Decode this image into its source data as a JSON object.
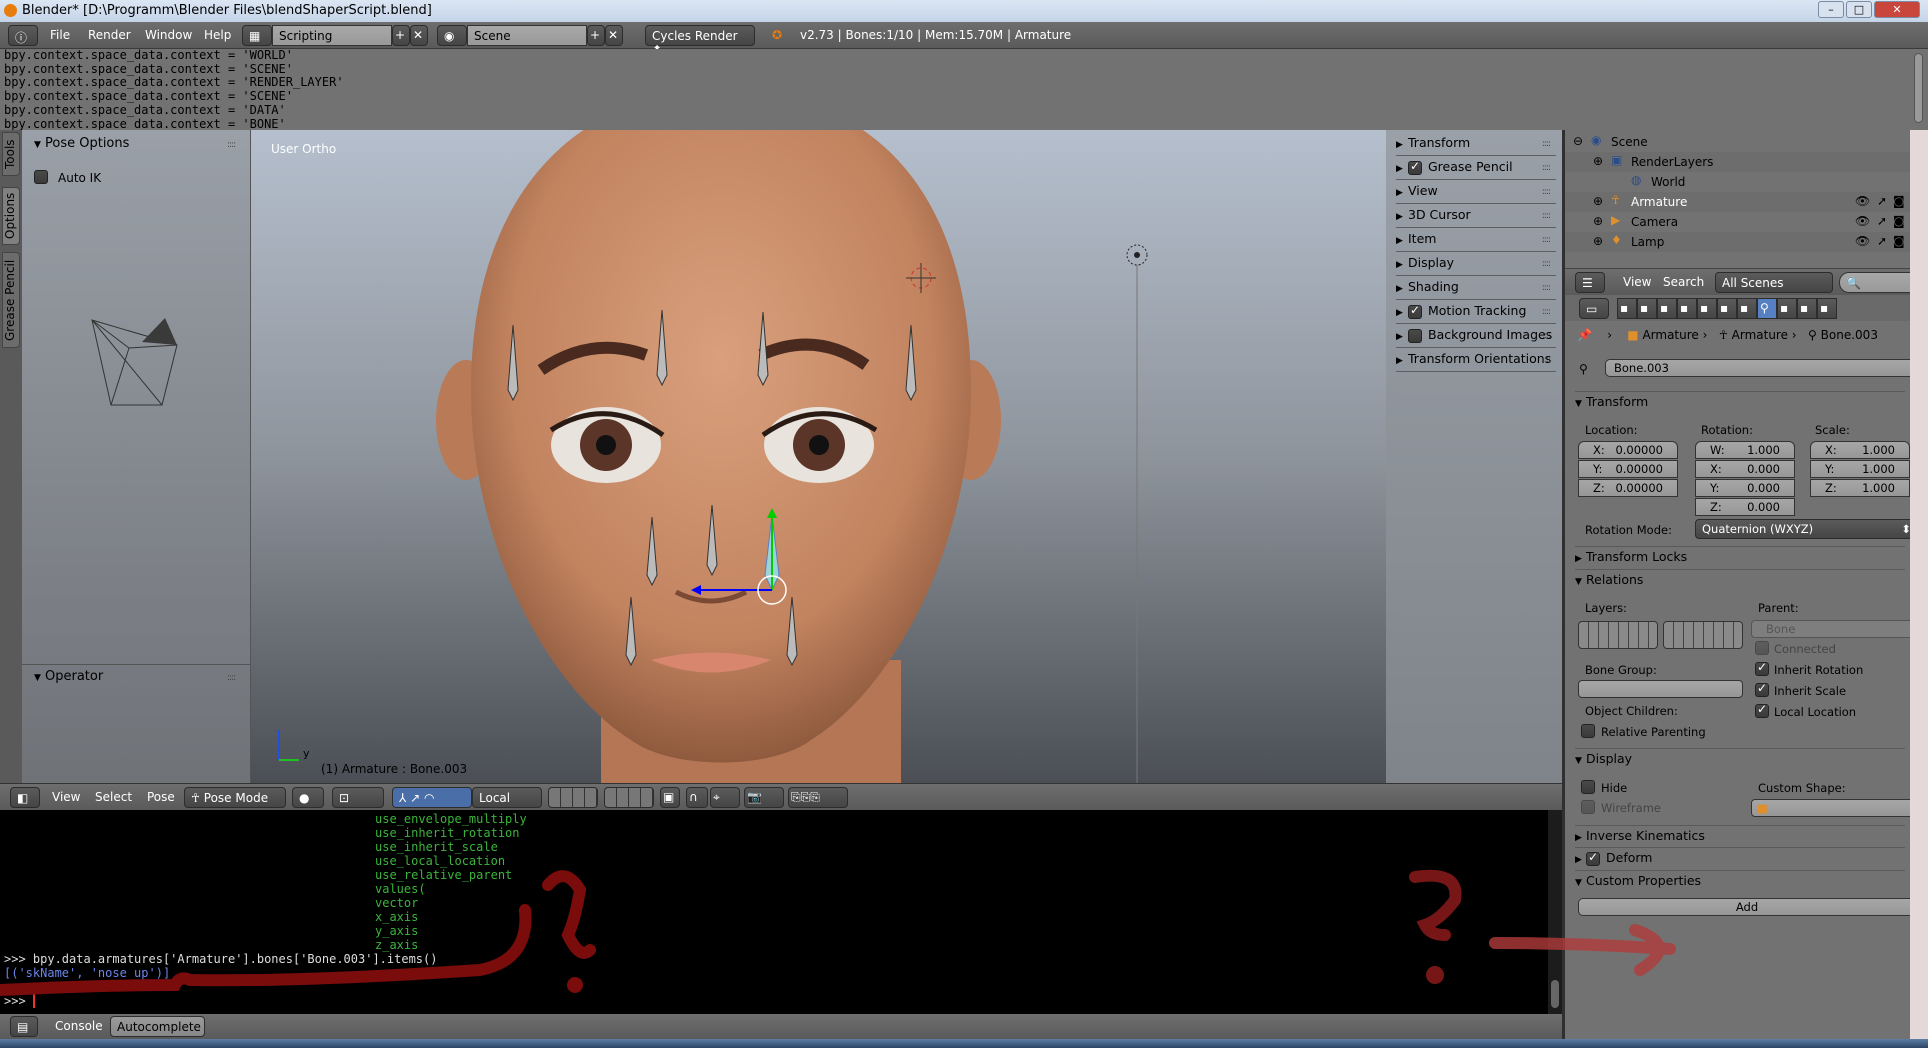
{
  "window": {
    "title": "Blender* [D:\\Programm\\Blender Files\\blendShaperScript.blend]"
  },
  "topbar": {
    "menus": [
      "File",
      "Render",
      "Window",
      "Help"
    ],
    "screen_layout": "Scripting",
    "scene": "Scene",
    "render_engine": "Cycles Render",
    "stats": "v2.73 | Bones:1/10  | Mem:15.70M | Armature"
  },
  "info_log": [
    "bpy.context.space_data.context = 'WORLD'",
    "bpy.context.space_data.context = 'SCENE'",
    "bpy.context.space_data.context = 'RENDER_LAYER'",
    "bpy.context.space_data.context = 'SCENE'",
    "bpy.context.space_data.context = 'DATA'",
    "bpy.context.space_data.context = 'BONE'"
  ],
  "tool_tabs": [
    "Tools",
    "Options",
    "Grease Pencil"
  ],
  "tool_panel": {
    "pose_options": "Pose Options",
    "auto_ik": "Auto IK",
    "auto_ik_checked": false,
    "operator": "Operator"
  },
  "viewport": {
    "view_label": "User Ortho",
    "status": "(1) Armature : Bone.003",
    "axis_label": "y"
  },
  "n_panel": [
    {
      "label": "Transform",
      "check": null
    },
    {
      "label": "Grease Pencil",
      "check": true
    },
    {
      "label": "View",
      "check": null
    },
    {
      "label": "3D Cursor",
      "check": null
    },
    {
      "label": "Item",
      "check": null
    },
    {
      "label": "Display",
      "check": null
    },
    {
      "label": "Shading",
      "check": null
    },
    {
      "label": "Motion Tracking",
      "check": true
    },
    {
      "label": "Background Images",
      "check": false
    },
    {
      "label": "Transform Orientations",
      "check": null
    }
  ],
  "outliner": {
    "items": [
      {
        "label": "Scene",
        "icon": "scene-icon"
      },
      {
        "label": "RenderLayers",
        "icon": "render-layers-icon"
      },
      {
        "label": "World",
        "icon": "world-icon"
      },
      {
        "label": "Armature",
        "icon": "armature-icon"
      },
      {
        "label": "Camera",
        "icon": "camera-icon"
      },
      {
        "label": "Lamp",
        "icon": "lamp-icon"
      }
    ],
    "header": {
      "view": "View",
      "search": "Search",
      "filter": "All Scenes"
    }
  },
  "properties": {
    "breadcrumb": [
      "Armature",
      "Armature",
      "Bone.003"
    ],
    "bone_name": "Bone.003",
    "transform": {
      "title": "Transform",
      "location_label": "Location:",
      "rotation_label": "Rotation:",
      "scale_label": "Scale:",
      "location": [
        [
          "X:",
          "0.00000"
        ],
        [
          "Y:",
          "0.00000"
        ],
        [
          "Z:",
          "0.00000"
        ]
      ],
      "rotation": [
        [
          "W:",
          "1.000"
        ],
        [
          "X:",
          "0.000"
        ],
        [
          "Y:",
          "0.000"
        ],
        [
          "Z:",
          "0.000"
        ]
      ],
      "scale": [
        [
          "X:",
          "1.000"
        ],
        [
          "Y:",
          "1.000"
        ],
        [
          "Z:",
          "1.000"
        ]
      ],
      "rotation_mode_label": "Rotation Mode:",
      "rotation_mode": "Quaternion (WXYZ)"
    },
    "transform_locks": "Transform Locks",
    "relations": {
      "title": "Relations",
      "layers_label": "Layers:",
      "parent_label": "Parent:",
      "parent_placeholder": "Bone",
      "connected": "Connected",
      "bone_group_label": "Bone Group:",
      "inherit_rotation": "Inherit Rotation",
      "inherit_scale": "Inherit Scale",
      "object_children_label": "Object Children:",
      "local_location": "Local Location",
      "relative_parenting": "Relative Parenting"
    },
    "display": {
      "title": "Display",
      "hide": "Hide",
      "wireframe": "Wireframe",
      "custom_shape_label": "Custom Shape:"
    },
    "inverse_kinematics": "Inverse Kinematics",
    "deform": "Deform",
    "custom_properties": {
      "title": "Custom Properties",
      "add": "Add"
    }
  },
  "view3d_header": {
    "menus": [
      "View",
      "Select",
      "Pose"
    ],
    "mode": "Pose Mode",
    "orientation": "Local"
  },
  "console": {
    "completions": [
      "use_envelope_multiply",
      "use_inherit_rotation",
      "use_inherit_scale",
      "use_local_location",
      "use_relative_parent",
      "values(",
      "vector",
      "x_axis",
      "y_axis",
      "z_axis"
    ],
    "command": ">>> bpy.data.armatures['Armature'].bones['Bone.003'].items()",
    "output": "[('skName', 'nose_up')]",
    "prompt": ">>> "
  },
  "console_header": {
    "console": "Console",
    "autocomplete": "Autocomplete"
  },
  "colors": {
    "annotation": "#7a0c0c",
    "console_green": "#3cb43c",
    "console_output": "#6b86e8",
    "selected_bone_accent": "#5680c2"
  }
}
